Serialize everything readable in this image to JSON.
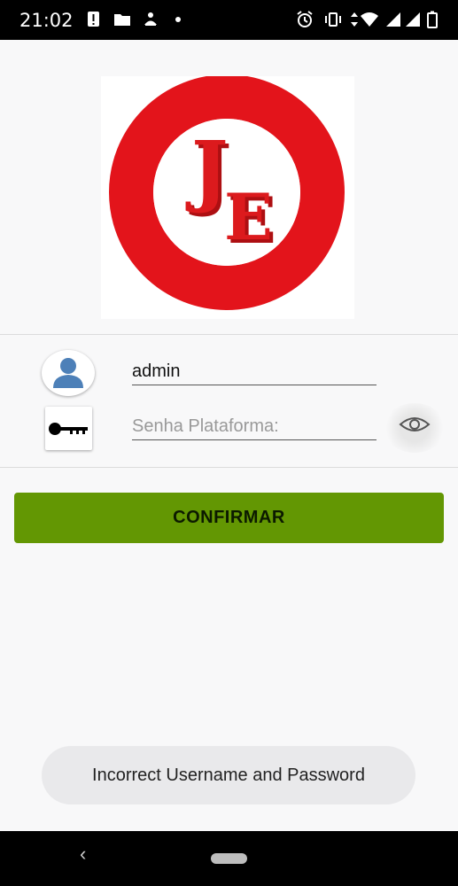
{
  "status_bar": {
    "time": "21:02",
    "left_icons": [
      "alert-icon",
      "folder-icon",
      "app-icon",
      "dot-icon"
    ],
    "right_icons": [
      "alarm-icon",
      "vibrate-icon",
      "data-icon",
      "wifi-icon",
      "signal-icon",
      "signal-icon",
      "battery-icon"
    ]
  },
  "logo": {
    "letters": "JE",
    "ring_color": "#e3141b",
    "letter_color": "#cc1518"
  },
  "login": {
    "username_value": "admin",
    "password_placeholder": "Senha Plataforma:",
    "confirm_label": "CONFIRMAR"
  },
  "toast": {
    "message": "Incorrect Username and Password"
  },
  "colors": {
    "accent": "#639703",
    "background": "#f8f8f9"
  }
}
